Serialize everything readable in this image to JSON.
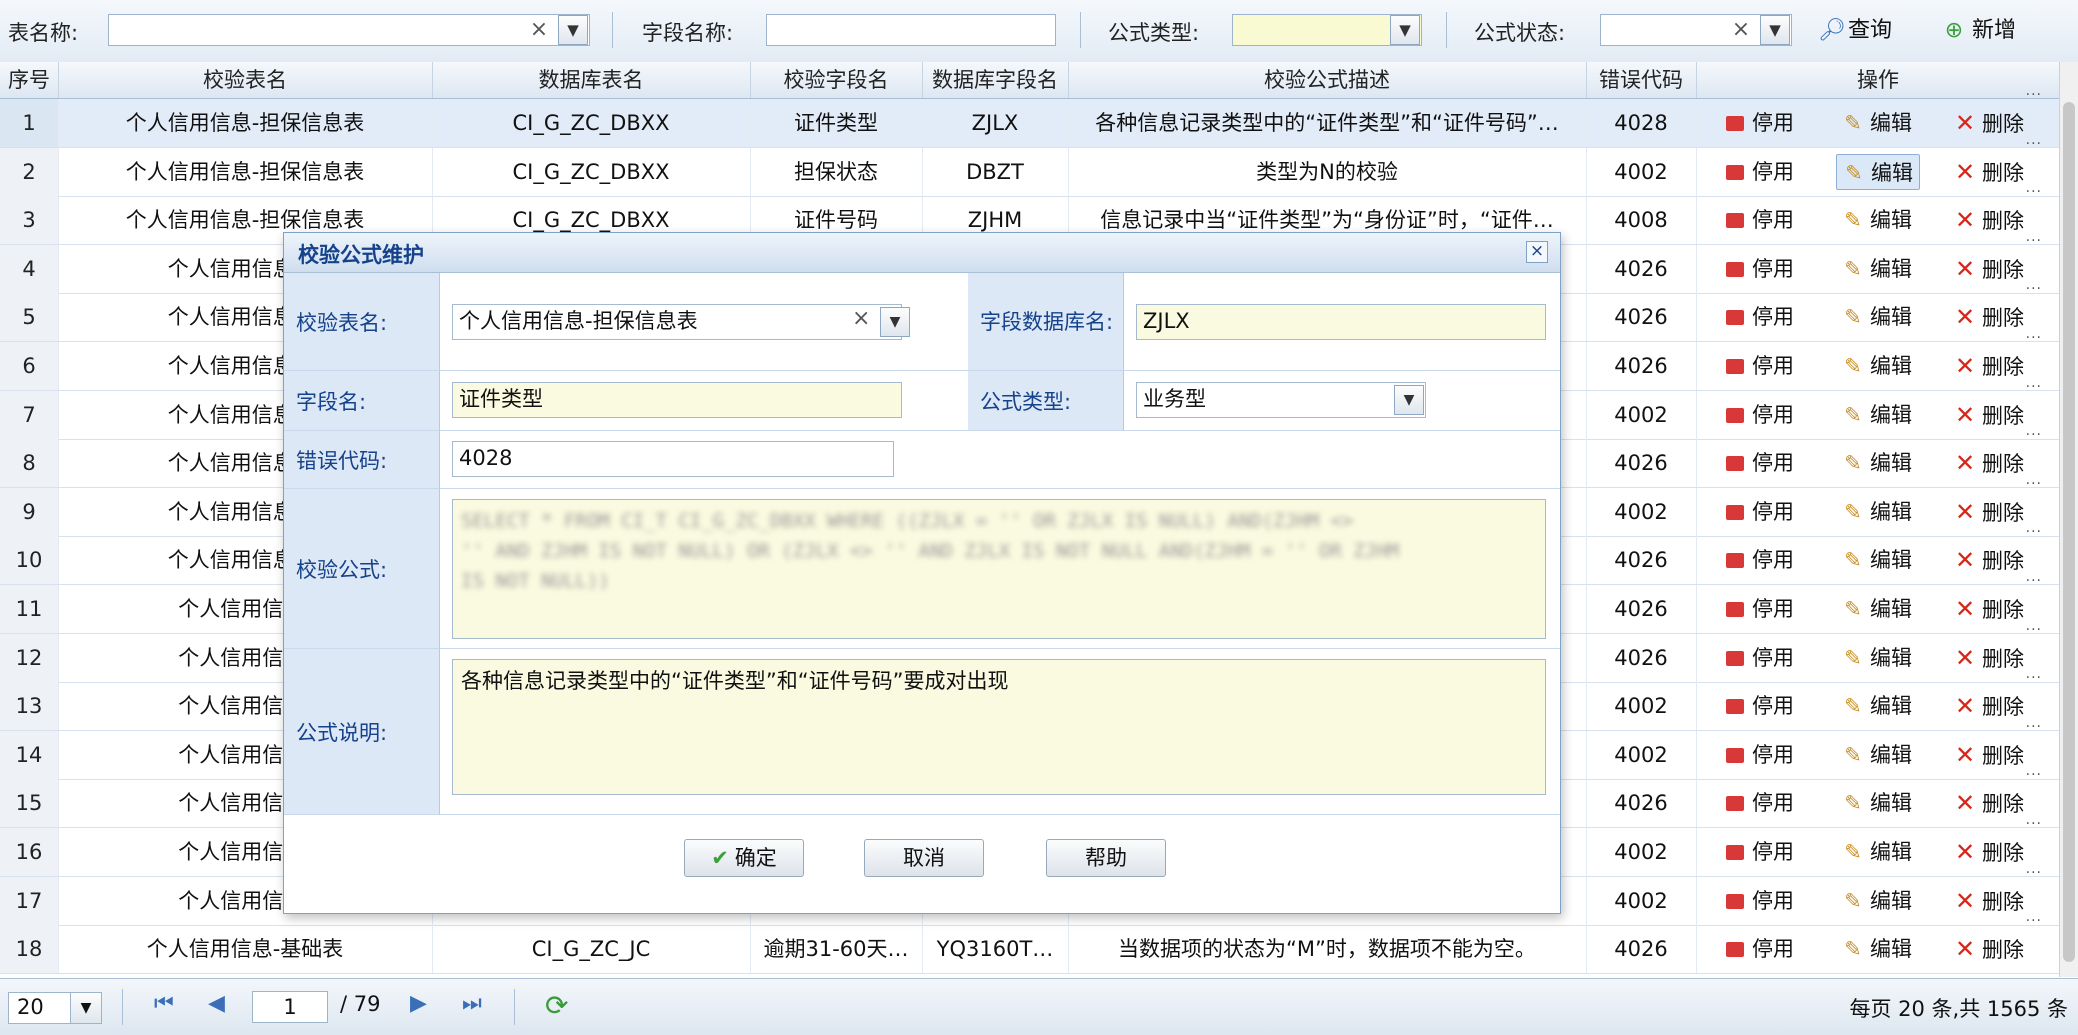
{
  "toolbar": {
    "table_name_label": "表名称:",
    "field_name_label": "字段名称:",
    "formula_type_label": "公式类型:",
    "formula_status_label": "公式状态:",
    "query_label": "查询",
    "add_label": "新增",
    "clear_glyph": "×",
    "drop_glyph": "▼"
  },
  "grid": {
    "headers": [
      "序号",
      "校验表名",
      "数据库表名",
      "校验字段名",
      "数据库字段名",
      "校验公式描述",
      "错误代码",
      "操作"
    ],
    "actions": {
      "stop": "停用",
      "edit": "编辑",
      "delete": "删除"
    },
    "rows": [
      {
        "idx": "1",
        "table": "个人信用信息-担保信息表",
        "db_table": "CI_G_ZC_DBXX",
        "field": "证件类型",
        "db_field": "ZJLX",
        "desc": "各种信息记录类型中的“证件类型”和“证件号码”…",
        "code": "4028"
      },
      {
        "idx": "2",
        "table": "个人信用信息-担保信息表",
        "db_table": "CI_G_ZC_DBXX",
        "field": "担保状态",
        "db_field": "DBZT",
        "desc": "类型为N的校验",
        "code": "4002"
      },
      {
        "idx": "3",
        "table": "个人信用信息-担保信息表",
        "db_table": "CI_G_ZC_DBXX",
        "field": "证件号码",
        "db_field": "ZJHM",
        "desc": "信息记录中当“证件类型”为“身份证”时，“证件…",
        "code": "4008"
      },
      {
        "idx": "4",
        "table": "个人信用信息-担",
        "db_table": "",
        "field": "",
        "db_field": "",
        "desc": "",
        "code": "4026"
      },
      {
        "idx": "5",
        "table": "个人信用信息-担",
        "db_table": "",
        "field": "",
        "db_field": "",
        "desc": "",
        "code": "4026"
      },
      {
        "idx": "6",
        "table": "个人信用信息-担",
        "db_table": "",
        "field": "",
        "db_field": "",
        "desc": "",
        "code": "4026"
      },
      {
        "idx": "7",
        "table": "个人信用信息-担",
        "db_table": "",
        "field": "",
        "db_field": "",
        "desc": "",
        "code": "4002"
      },
      {
        "idx": "8",
        "table": "个人信用信息-担",
        "db_table": "",
        "field": "",
        "db_field": "",
        "desc": "",
        "code": "4026"
      },
      {
        "idx": "9",
        "table": "个人信用信息-担",
        "db_table": "",
        "field": "",
        "db_field": "",
        "desc": "",
        "code": "4002"
      },
      {
        "idx": "10",
        "table": "个人信用信息-担",
        "db_table": "",
        "field": "",
        "db_field": "",
        "desc": "",
        "code": "4026"
      },
      {
        "idx": "11",
        "table": "个人信用信息-",
        "db_table": "",
        "field": "",
        "db_field": "",
        "desc": "",
        "code": "4026"
      },
      {
        "idx": "12",
        "table": "个人信用信息-",
        "db_table": "",
        "field": "",
        "db_field": "",
        "desc": "",
        "code": "4026"
      },
      {
        "idx": "13",
        "table": "个人信用信息-",
        "db_table": "",
        "field": "",
        "db_field": "",
        "desc": "",
        "code": "4002"
      },
      {
        "idx": "14",
        "table": "个人信用信息-",
        "db_table": "",
        "field": "",
        "db_field": "",
        "desc": "",
        "code": "4002"
      },
      {
        "idx": "15",
        "table": "个人信用信息-",
        "db_table": "",
        "field": "",
        "db_field": "",
        "desc": "",
        "code": "4026"
      },
      {
        "idx": "16",
        "table": "个人信用信息-",
        "db_table": "",
        "field": "",
        "db_field": "",
        "desc": "",
        "code": "4002"
      },
      {
        "idx": "17",
        "table": "个人信用信息-",
        "db_table": "",
        "field": "",
        "db_field": "",
        "desc": "",
        "code": "4002"
      },
      {
        "idx": "18",
        "table": "个人信用信息-基础表",
        "db_table": "CI_G_ZC_JC",
        "field": "逾期31-60天…",
        "db_field": "YQ3160T…",
        "desc": "当数据项的状态为“M”时，数据项不能为空。",
        "code": "4026"
      }
    ]
  },
  "pager": {
    "page_size": "20",
    "current_page": "1",
    "total_pages": "/ 79",
    "info": "每页 20 条,共 1565 条"
  },
  "modal": {
    "title": "校验公式维护",
    "close_glyph": "×",
    "table_name_label": "校验表名:",
    "table_name_value": "个人信用信息-担保信息表",
    "db_field_label": "字段数据库名:",
    "db_field_value": "ZJLX",
    "field_name_label": "字段名:",
    "field_name_value": "证件类型",
    "formula_type_label": "公式类型:",
    "formula_type_value": "业务型",
    "error_code_label": "错误代码:",
    "error_code_value": "4028",
    "formula_label": "校验公式:",
    "formula_line1": "SELECT * FROM CI_T CI_G_ZC_DBXX WHERE ((ZJLX = '' OR ZJLX IS NULL) AND(ZJHM <>",
    "formula_line2": "'' AND ZJHM IS NOT NULL) OR (ZJLX <> '' AND ZJLX IS NOT NULL AND(ZJHM = '' OR ZJHM",
    "formula_line3": "IS NOT NULL))",
    "desc_label": "公式说明:",
    "desc_value": "各种信息记录类型中的“证件类型”和“证件号码”要成对出现",
    "ok_label": "确定",
    "cancel_label": "取消",
    "help_label": "帮助"
  }
}
